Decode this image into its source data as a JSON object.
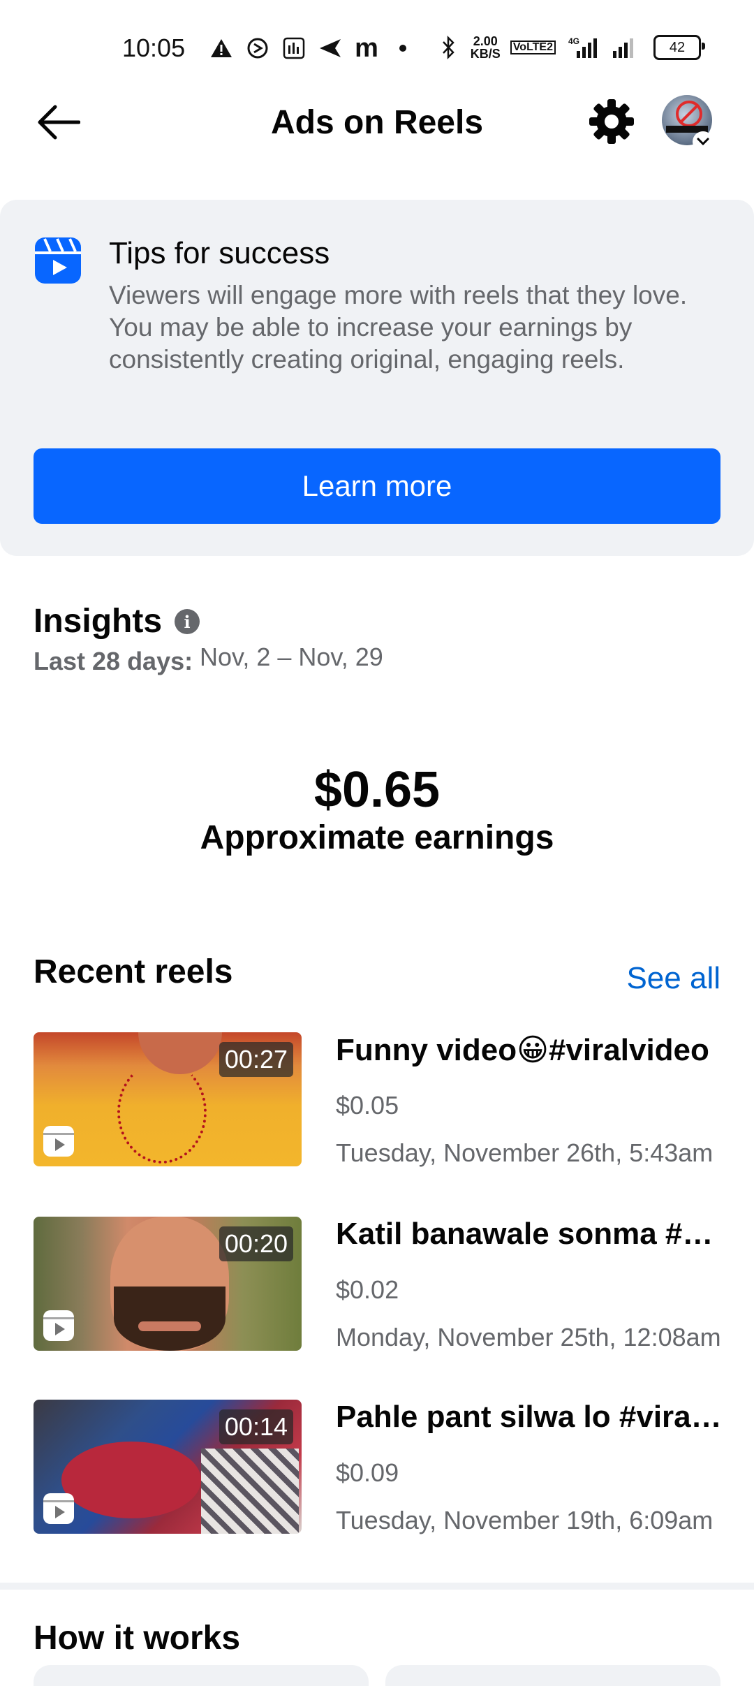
{
  "status_bar": {
    "time": "10:05",
    "net_speed_value": "2.00",
    "net_speed_unit": "KB/S",
    "volte": "VoLTE2",
    "network": "4G",
    "battery": "42"
  },
  "header": {
    "title": "Ads on Reels",
    "back_icon": "arrow-left-icon",
    "settings_icon": "gear-icon"
  },
  "tips": {
    "title": "Tips for success",
    "body": "Viewers will engage more with reels that they love. You may be able to increase your earnings by consistently creating original, engaging reels.",
    "button_label": "Learn more",
    "accent_color": "#0866ff"
  },
  "insights": {
    "title": "Insights",
    "period_label": "Last 28 days:",
    "period_range": "Nov, 2 – Nov, 29",
    "earnings_value": "$0.65",
    "earnings_label": "Approximate earnings"
  },
  "recent_reels": {
    "title": "Recent reels",
    "see_all_label": "See all",
    "items": [
      {
        "duration": "00:27",
        "title": "Funny video😀#viralvideo",
        "earnings": "$0.05",
        "date": "Tuesday, November 26th, 5:43am"
      },
      {
        "duration": "00:20",
        "title": "Katil banawale sonma #viral",
        "earnings": "$0.02",
        "date": "Monday, November 25th, 12:08am"
      },
      {
        "duration": "00:14",
        "title": "Pahle pant silwa lo #viralreels",
        "earnings": "$0.09",
        "date": "Tuesday, November 19th, 6:09am"
      }
    ]
  },
  "how_it_works": {
    "title": "How it works"
  }
}
